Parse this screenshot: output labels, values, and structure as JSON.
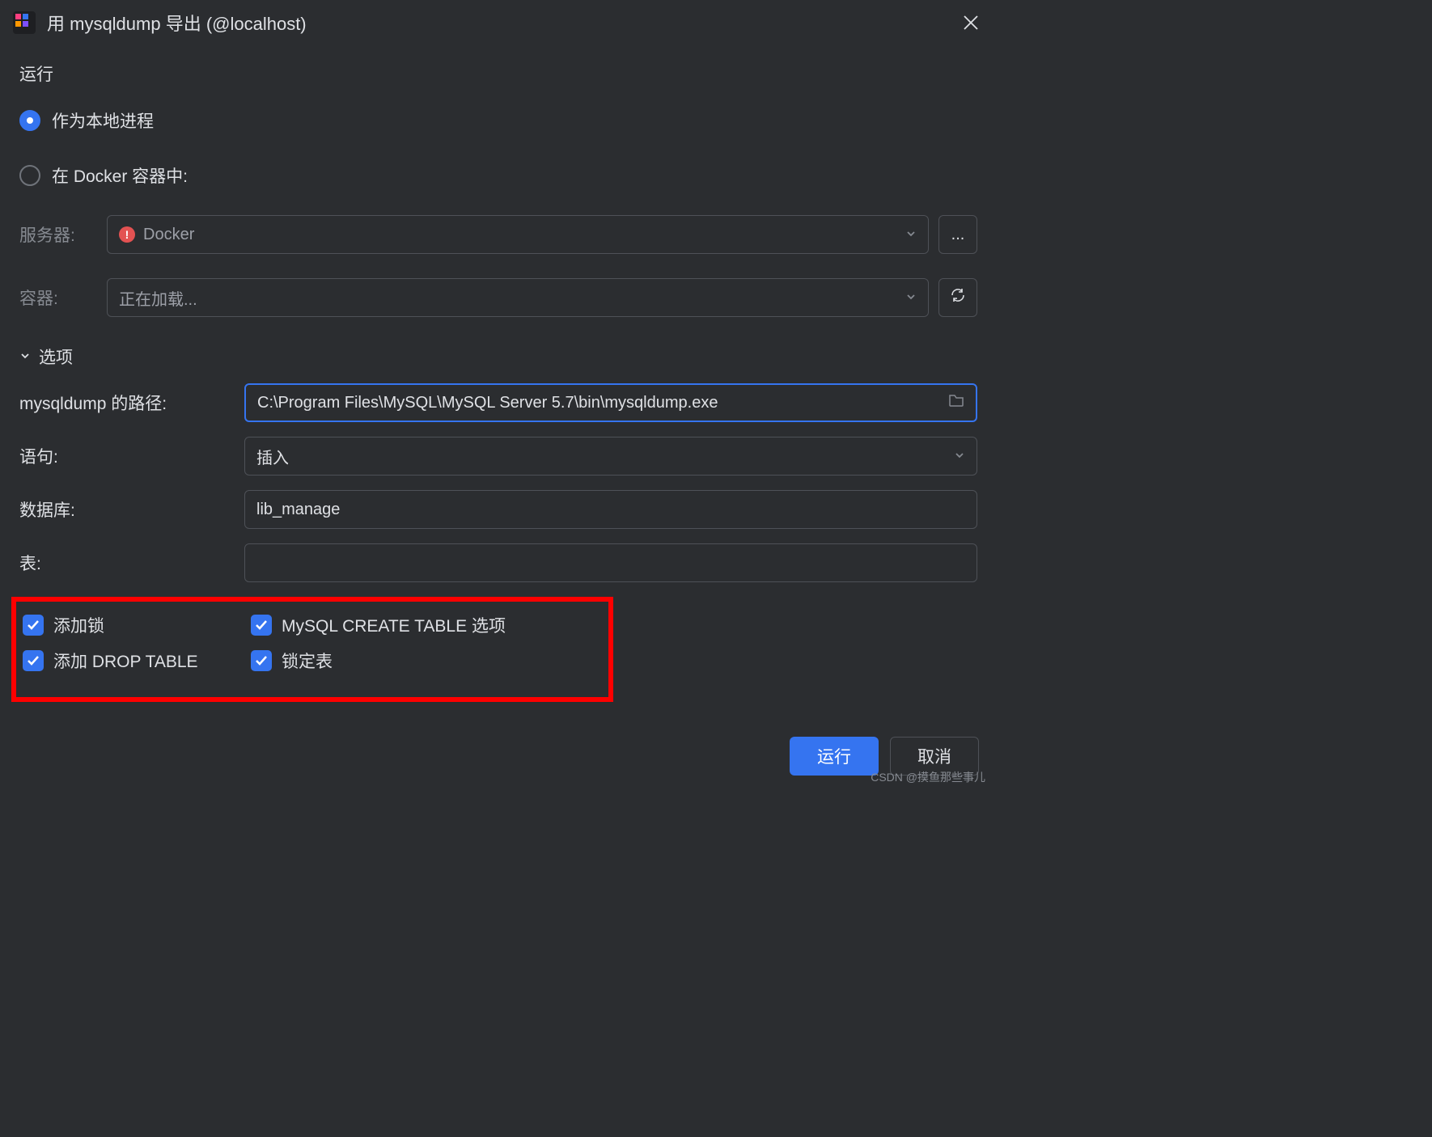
{
  "title": "用 mysqldump 导出 (@localhost)",
  "run": {
    "heading": "运行",
    "local_process": "作为本地进程",
    "docker": "在 Docker 容器中:"
  },
  "server": {
    "label": "服务器:",
    "value": "Docker",
    "more": "..."
  },
  "container": {
    "label": "容器:",
    "value": "正在加载..."
  },
  "options": {
    "heading": "选项",
    "path_label": "mysqldump 的路径:",
    "path_value": "C:\\Program Files\\MySQL\\MySQL Server 5.7\\bin\\mysqldump.exe",
    "statement_label": "语句:",
    "statement_value": "插入",
    "database_label": "数据库:",
    "database_value": "lib_manage",
    "tables_label": "表:",
    "tables_value": ""
  },
  "checks": {
    "add_locks": "添加锁",
    "create_table": "MySQL CREATE TABLE 选项",
    "drop_table": "添加 DROP TABLE",
    "lock_tables": "锁定表"
  },
  "buttons": {
    "run": "运行",
    "cancel": "取消"
  },
  "watermark": "CSDN @摸鱼那些事儿"
}
